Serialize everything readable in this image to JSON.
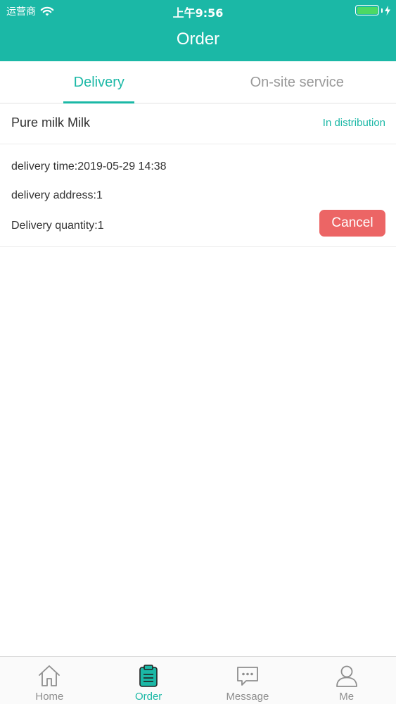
{
  "status_bar": {
    "carrier": "运营商",
    "time": "上午9:56"
  },
  "header": {
    "title": "Order"
  },
  "tabs": [
    {
      "label": "Delivery",
      "active": true
    },
    {
      "label": "On-site service",
      "active": false
    }
  ],
  "order": {
    "product_name": "Pure milk Milk",
    "status": "In distribution",
    "delivery_time": "delivery time:2019-05-29 14:38",
    "delivery_address": "delivery address:1",
    "delivery_quantity": "Delivery quantity:1",
    "cancel_label": "Cancel"
  },
  "tabbar": [
    {
      "label": "Home",
      "icon": "home-icon",
      "active": false
    },
    {
      "label": "Order",
      "icon": "order-clipboard-icon",
      "active": true
    },
    {
      "label": "Message",
      "icon": "message-icon",
      "active": false
    },
    {
      "label": "Me",
      "icon": "user-icon",
      "active": false
    }
  ],
  "colors": {
    "accent": "#1bb8a6",
    "cancel": "#ec6565",
    "battery": "#4cd964"
  }
}
